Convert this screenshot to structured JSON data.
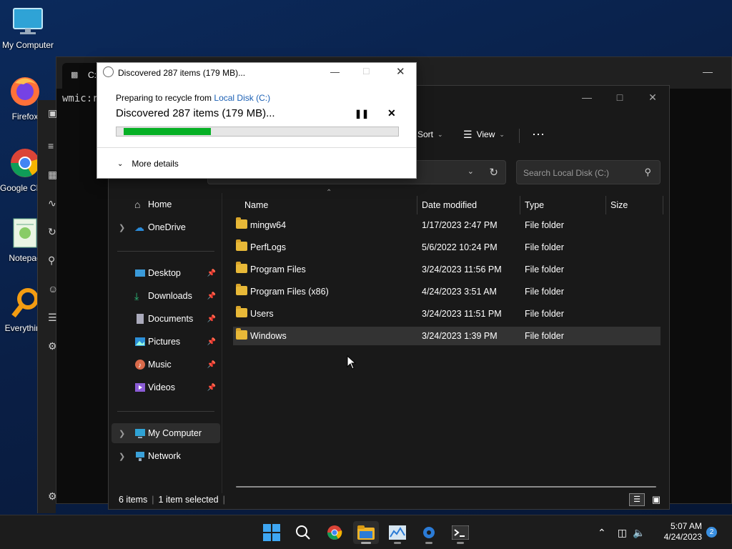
{
  "desktop": {
    "icons": [
      {
        "label": "My Computer",
        "icon": "monitor-icon"
      },
      {
        "label": "Firefox",
        "icon": "firefox-icon"
      },
      {
        "label": "Google Chrome",
        "icon": "chrome-icon"
      },
      {
        "label": "Notepad",
        "icon": "notepad-icon"
      },
      {
        "label": "Everything",
        "icon": "everything-icon"
      }
    ]
  },
  "terminal": {
    "tab_title": "C:\\",
    "text": "wmic:r"
  },
  "explorer": {
    "toolbar": {
      "sort_label": "Sort",
      "view_label": "View",
      "more": "⋯"
    },
    "search_placeholder": "Search Local Disk (C:)",
    "nav": [
      {
        "label": "Home",
        "icon": "home-icon"
      },
      {
        "label": "OneDrive",
        "icon": "cloud-icon"
      },
      {
        "label": "Desktop",
        "icon": "desktop-icon"
      },
      {
        "label": "Downloads",
        "icon": "download-icon"
      },
      {
        "label": "Documents",
        "icon": "document-icon"
      },
      {
        "label": "Pictures",
        "icon": "picture-icon"
      },
      {
        "label": "Music",
        "icon": "music-icon"
      },
      {
        "label": "Videos",
        "icon": "video-icon"
      },
      {
        "label": "My Computer",
        "icon": "computer-icon"
      },
      {
        "label": "Network",
        "icon": "network-icon"
      }
    ],
    "columns": [
      "Name",
      "Date modified",
      "Type",
      "Size"
    ],
    "rows": [
      {
        "name": "mingw64",
        "date": "1/17/2023 2:47 PM",
        "type": "File folder"
      },
      {
        "name": "PerfLogs",
        "date": "5/6/2022 10:24 PM",
        "type": "File folder"
      },
      {
        "name": "Program Files",
        "date": "3/24/2023 11:56 PM",
        "type": "File folder"
      },
      {
        "name": "Program Files (x86)",
        "date": "4/24/2023 3:51 AM",
        "type": "File folder"
      },
      {
        "name": "Users",
        "date": "3/24/2023 11:51 PM",
        "type": "File folder"
      },
      {
        "name": "Windows",
        "date": "3/24/2023 1:39 PM",
        "type": "File folder"
      }
    ],
    "status": {
      "items": "6 items",
      "selected": "1 item selected"
    }
  },
  "dialog": {
    "title": "Discovered 287 items (179 MB)...",
    "preparing_text": "Preparing to recycle from ",
    "location_link": "Local Disk (C:)",
    "headline": "Discovered 287 items (179 MB)...",
    "progress_fraction": 0.32,
    "more_details": "More details",
    "accent": "#06b025"
  },
  "taskbar": {
    "time": "5:07 AM",
    "date": "4/24/2023",
    "notification_count": "2"
  }
}
